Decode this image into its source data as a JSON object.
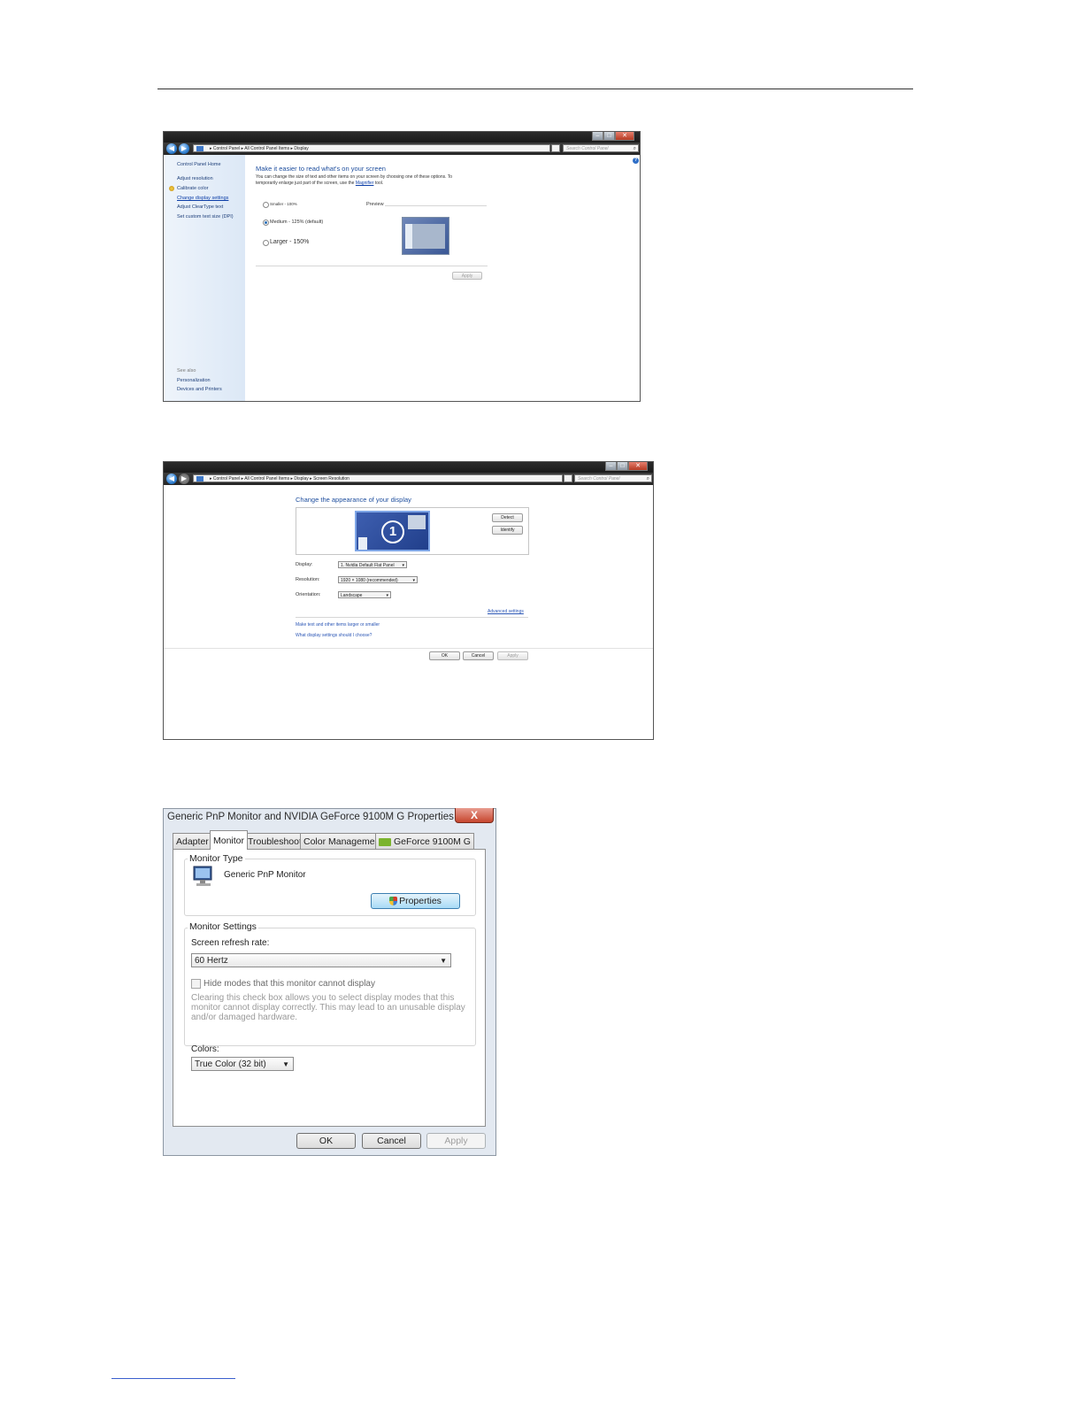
{
  "window1": {
    "breadcrumb": [
      "Control Panel",
      "All Control Panel Items",
      "Display"
    ],
    "search_placeholder": "Search Control Panel",
    "sidebar": {
      "home": "Control Panel Home",
      "items": [
        "Adjust resolution",
        "Calibrate color",
        "Change display settings",
        "Adjust ClearType text",
        "Set custom text size (DPI)"
      ],
      "see_also_title": "See also",
      "see_also": [
        "Personalization",
        "Devices and Printers"
      ]
    },
    "title": "Make it easier to read what's on your screen",
    "desc_line1": "You can change the size of text and other items on your screen by choosing one of these options. To",
    "desc_line2_pre": "temporarily enlarge just part of the screen, use the",
    "desc_link": "Magnifier",
    "desc_line2_post": "tool.",
    "options": [
      {
        "label": "Smaller - 100%",
        "selected": false
      },
      {
        "label": "Medium - 125% (default)",
        "selected": true
      },
      {
        "label": "Larger - 150%",
        "selected": false
      }
    ],
    "preview_label": "Preview",
    "apply": "Apply"
  },
  "window2": {
    "breadcrumb": [
      "Control Panel",
      "All Control Panel Items",
      "Display",
      "Screen Resolution"
    ],
    "search_placeholder": "Search Control Panel",
    "title": "Change the appearance of your display",
    "monitor_number": "1",
    "detect": "Detect",
    "identify": "Identify",
    "display_label": "Display:",
    "display_value": "1. Nvidia Default Flat Panel",
    "resolution_label": "Resolution:",
    "resolution_value": "1920 × 1080 (recommended)",
    "orientation_label": "Orientation:",
    "orientation_value": "Landscape",
    "advanced": "Advanced settings",
    "link1": "Make text and other items larger or smaller",
    "link2": "What display settings should I choose?",
    "ok": "OK",
    "cancel": "Cancel",
    "apply": "Apply"
  },
  "dialog": {
    "title": "Generic PnP Monitor and NVIDIA GeForce 9100M G   Properties",
    "close": "X",
    "tabs": [
      "Adapter",
      "Monitor",
      "Troubleshoot",
      "Color Management",
      "GeForce 9100M G"
    ],
    "active_tab": "Monitor",
    "monitor_type_legend": "Monitor Type",
    "monitor_name": "Generic PnP Monitor",
    "properties_button": "Properties",
    "monitor_settings_legend": "Monitor Settings",
    "refresh_label": "Screen refresh rate:",
    "refresh_value": "60 Hertz",
    "hide_modes_label": "Hide modes that this monitor cannot display",
    "hide_modes_checked": false,
    "hint_text": "Clearing this check box allows you to select display modes that this monitor cannot display correctly. This may lead to an unusable display and/or damaged hardware.",
    "colors_label": "Colors:",
    "colors_value": "True Color (32 bit)",
    "ok": "OK",
    "cancel": "Cancel",
    "apply": "Apply"
  }
}
